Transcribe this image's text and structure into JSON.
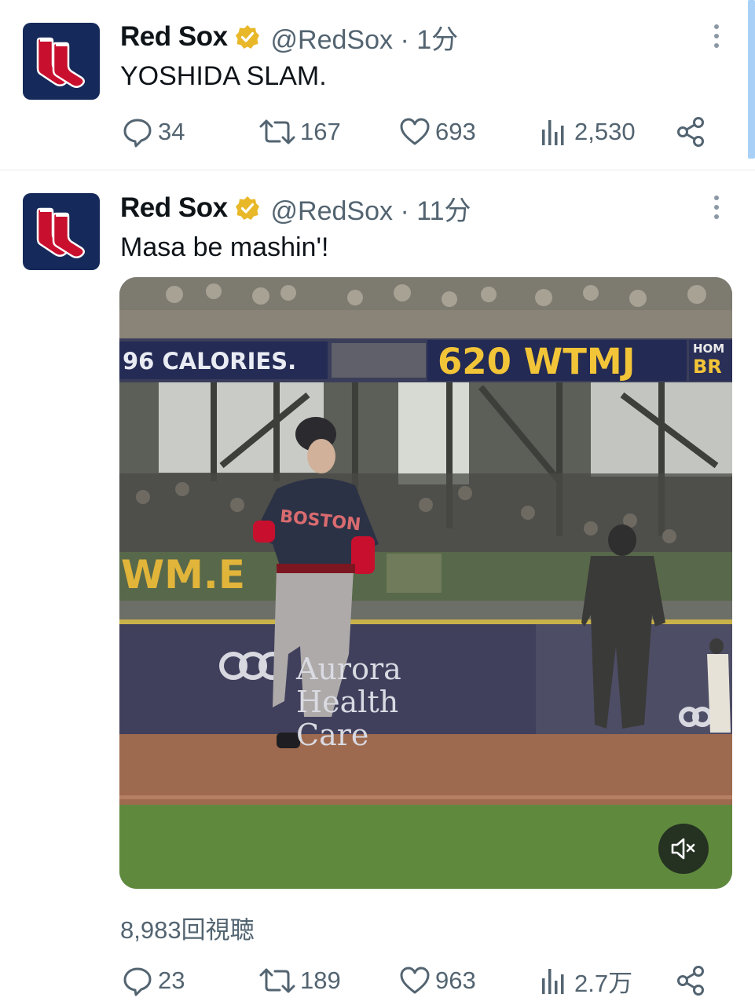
{
  "tweets": [
    {
      "author_name": "Red Sox",
      "handle_time": "@RedSox · 1分",
      "text": "YOSHIDA SLAM.",
      "stats": {
        "replies": "34",
        "reposts": "167",
        "likes": "693",
        "views": "2,530"
      }
    },
    {
      "author_name": "Red Sox",
      "handle_time": "@RedSox · 11分",
      "text": "Masa be mashin'!",
      "media": {
        "board_calories": "96 CALORIES.",
        "board_radio": "620 WTMJ",
        "board_home_top": "HOM",
        "board_home_bottom": "BR",
        "wall_left": "WM.E",
        "wall_sign": "Aurora Health Care",
        "jersey": "BOSTON",
        "mute_icon": "speaker-muted-icon"
      },
      "view_count": "8,983回視聴",
      "stats": {
        "replies": "23",
        "reposts": "189",
        "likes": "963",
        "views": "2.7万"
      }
    }
  ],
  "colors": {
    "verified_gold": "#e8b829",
    "avatar_navy": "#152a5a",
    "sox_red": "#c8102e",
    "muted_text": "#536471"
  }
}
